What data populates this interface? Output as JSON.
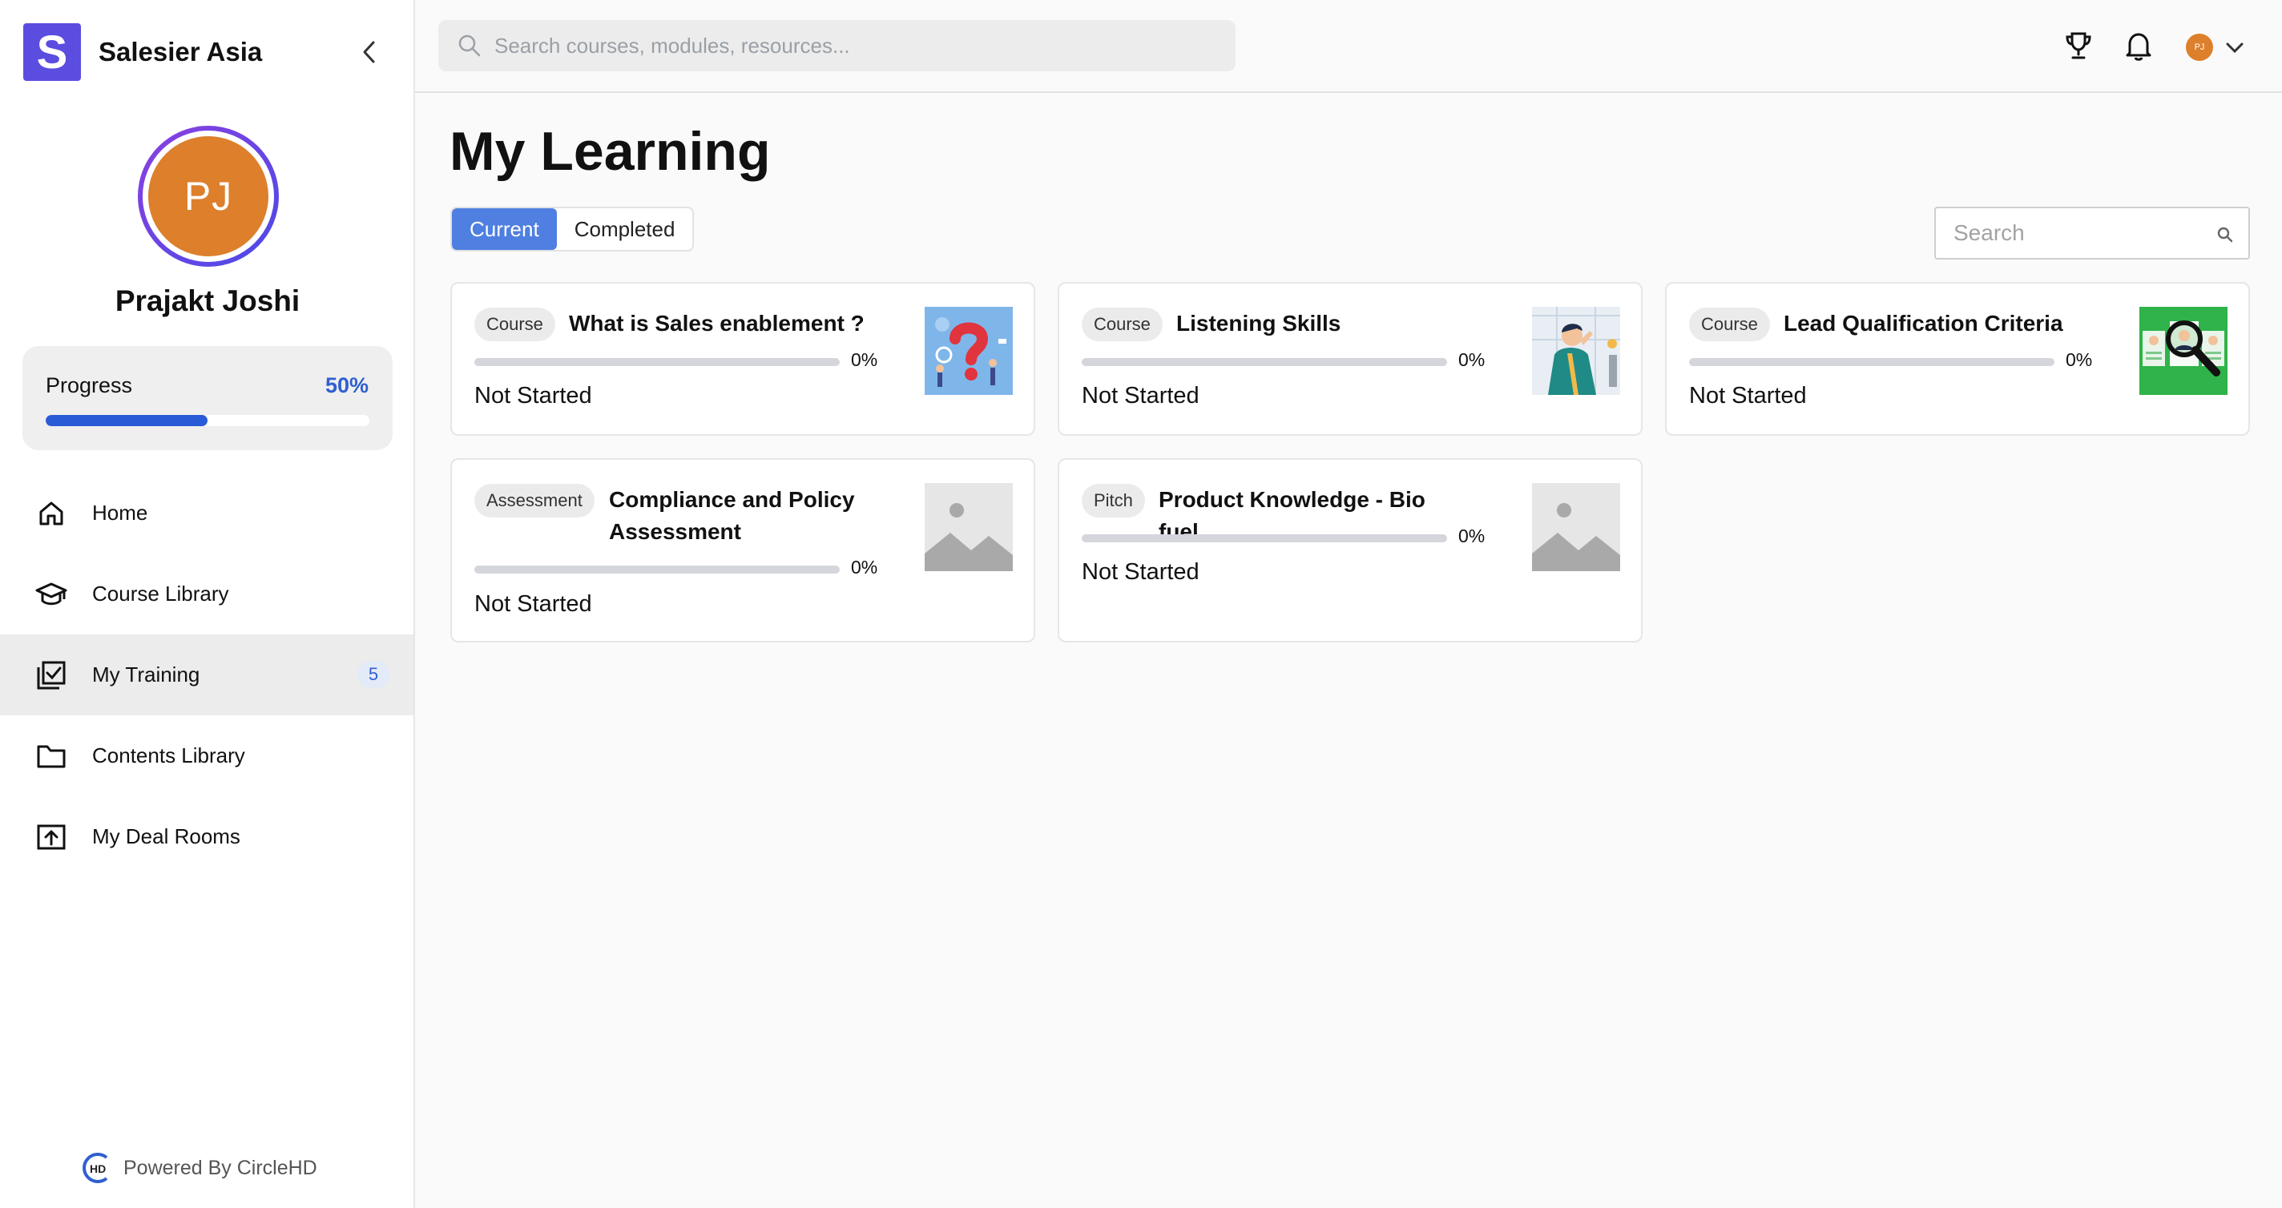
{
  "brand": {
    "logo_letter": "S",
    "name": "Salesier Asia"
  },
  "user": {
    "initials": "PJ",
    "name": "Prajakt Joshi"
  },
  "progress": {
    "label": "Progress",
    "value_text": "50%",
    "fraction": 0.5
  },
  "nav": {
    "items": [
      {
        "label": "Home",
        "icon": "home-icon"
      },
      {
        "label": "Course Library",
        "icon": "graduation-cap-icon"
      },
      {
        "label": "My Training",
        "icon": "checklist-icon",
        "badge": "5",
        "active": true
      },
      {
        "label": "Contents Library",
        "icon": "folder-icon"
      },
      {
        "label": "My Deal Rooms",
        "icon": "upload-box-icon"
      }
    ]
  },
  "footer": {
    "powered_text": "Powered By CircleHD",
    "logo_text": "HD"
  },
  "topbar": {
    "search_placeholder": "Search courses, modules, resources...",
    "avatar_initials": "PJ"
  },
  "main": {
    "title": "My Learning",
    "tabs": [
      {
        "label": "Current",
        "active": true
      },
      {
        "label": "Completed",
        "active": false
      }
    ],
    "search_placeholder": "Search",
    "cards": [
      {
        "type": "Course",
        "title": "What is Sales enablement ?",
        "progress_text": "0%",
        "progress": 0,
        "status": "Not Started",
        "thumb": "question-mark-illustration"
      },
      {
        "type": "Course",
        "title": "Listening Skills",
        "progress_text": "0%",
        "progress": 0,
        "status": "Not Started",
        "thumb": "person-listening-illustration"
      },
      {
        "type": "Course",
        "title": "Lead Qualification Criteria",
        "progress_text": "0%",
        "progress": 0,
        "status": "Not Started",
        "thumb": "magnifier-profiles-illustration"
      },
      {
        "type": "Assessment",
        "title": "Compliance and Policy Assessment",
        "progress_text": "0%",
        "progress": 0,
        "status": "Not Started",
        "thumb": "image-placeholder"
      },
      {
        "type": "Pitch",
        "title": "Product Knowledge - Bio fuel",
        "progress_text": "0%",
        "progress": 0,
        "status": "Not Started",
        "thumb": "image-placeholder"
      }
    ]
  },
  "colors": {
    "brand": "#5b4de0",
    "accent": "#2a5bd7",
    "tab_active": "#4f7fe0",
    "avatar": "#dd7f2b"
  }
}
